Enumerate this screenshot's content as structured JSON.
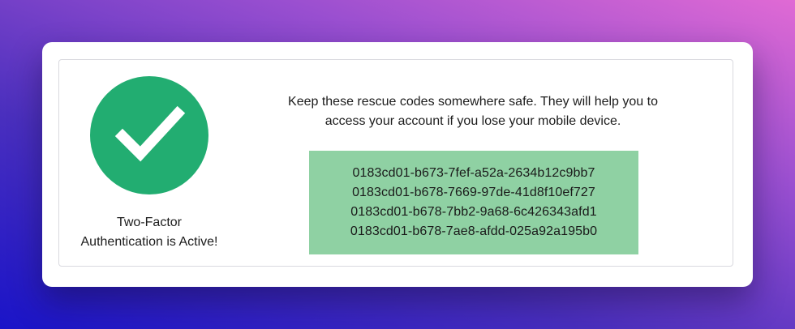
{
  "status": {
    "icon": "check-icon",
    "accent_color": "#22ad71",
    "line1": "Two-Factor",
    "line2": "Authentication is Active!"
  },
  "info": {
    "line1": "Keep these rescue codes somewhere safe. They will help you to",
    "line2": "access your account if you lose your mobile device."
  },
  "codes": {
    "background_color": "#8fd1a3",
    "items": [
      "0183cd01-b673-7fef-a52a-2634b12c9bb7",
      "0183cd01-b678-7669-97de-41d8f10ef727",
      "0183cd01-b678-7bb2-9a68-6c426343afd1",
      "0183cd01-b678-7ae8-afdd-025a92a195b0"
    ]
  }
}
